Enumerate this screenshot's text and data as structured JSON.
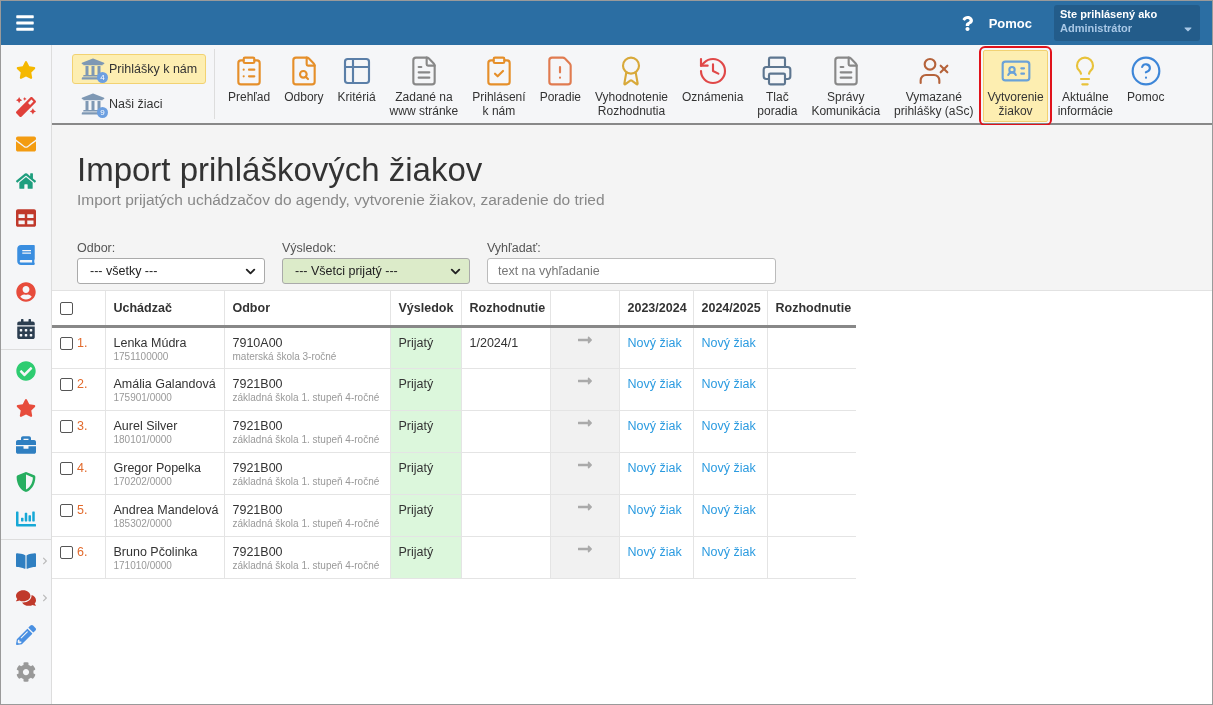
{
  "topbar": {
    "help": "Pomoc",
    "user_caption": "Ste prihlásený ako",
    "user_name": "Administrátor"
  },
  "side_buttons": [
    {
      "label": "Prihlášky k nám",
      "badge": "4",
      "selected": true
    },
    {
      "label": "Naši žiaci",
      "badge": "9",
      "selected": false
    }
  ],
  "toolbar": [
    {
      "label": "Prehľad",
      "selected": false
    },
    {
      "label": "Odbory",
      "selected": false
    },
    {
      "label": "Kritériá",
      "selected": false
    },
    {
      "label": "Zadané na\nwww stránke",
      "selected": false
    },
    {
      "label": "Prihlásení\nk nám",
      "selected": false
    },
    {
      "label": "Poradie",
      "selected": false
    },
    {
      "label": "Vyhodnotenie\nRozhodnutia",
      "selected": false
    },
    {
      "label": "Oznámenia",
      "selected": false
    },
    {
      "label": "Tlač\nporadia",
      "selected": false
    },
    {
      "label": "Správy\nKomunikácia",
      "selected": false
    },
    {
      "label": "Vymazané\nprihlášky (aSc)",
      "selected": false
    },
    {
      "label": "Vytvorenie\nžiakov",
      "selected": true
    },
    {
      "label": "Aktuálne\ninformácie",
      "selected": false
    },
    {
      "label": "Pomoc",
      "selected": false
    }
  ],
  "page": {
    "title": "Import prihláškových žiakov",
    "subtitle": "Import prijatých uchádzačov do agendy, vytvorenie žiakov, zaradenie do tried"
  },
  "filters": [
    {
      "kind": "select",
      "label": "Odbor:",
      "value": "--- všetky ---",
      "highlighted": false
    },
    {
      "kind": "select",
      "label": "Výsledok:",
      "value": "--- Všetci prijatý ---",
      "highlighted": true
    },
    {
      "kind": "text",
      "label": "Vyhľadať:",
      "placeholder": "text na vyhľadanie"
    }
  ],
  "table": {
    "select_all_checked": false,
    "columns": [
      "Uchádzač",
      "Odbor",
      "Výsledok",
      "Rozhodnutie",
      "2023/2024",
      "2024/2025",
      "Rozhodnutie"
    ],
    "rows": [
      {
        "checked": false,
        "number": "1.",
        "name": "Lenka Múdra",
        "id": "1751100000",
        "field_code": "7910A00",
        "field_name": "materská škola 3-ročné",
        "result": "Prijatý",
        "decision": "1/2024/1",
        "year_1": "Nový žiak",
        "year_2": "Nový žiak"
      },
      {
        "checked": false,
        "number": "2.",
        "name": "Amália Galandová",
        "id": "175901/0000",
        "field_code": "7921B00",
        "field_name": "základná škola 1. stupeň 4-ročné",
        "result": "Prijatý",
        "year_1": "Nový žiak",
        "year_2": "Nový žiak"
      },
      {
        "checked": false,
        "number": "3.",
        "name": "Aurel Silver",
        "id": "180101/0000",
        "field_code": "7921B00",
        "field_name": "základná škola 1. stupeň 4-ročné",
        "result": "Prijatý",
        "year_1": "Nový žiak",
        "year_2": "Nový žiak"
      },
      {
        "checked": false,
        "number": "4.",
        "name": "Gregor Popelka",
        "id": "170202/0000",
        "field_code": "7921B00",
        "field_name": "základná škola 1. stupeň 4-ročné",
        "result": "Prijatý",
        "year_1": "Nový žiak",
        "year_2": "Nový žiak"
      },
      {
        "checked": false,
        "number": "5.",
        "name": "Andrea Mandelová",
        "id": "185302/0000",
        "field_code": "7921B00",
        "field_name": "základná škola 1. stupeň 4-ročné",
        "result": "Prijatý",
        "year_1": "Nový žiak",
        "year_2": "Nový žiak"
      },
      {
        "checked": false,
        "number": "6.",
        "name": "Bruno Pčolinka",
        "id": "171010/0000",
        "field_code": "7921B00",
        "field_name": "základná škola 1. stupeň 4-ročné",
        "result": "Prijatý",
        "year_1": "Nový žiak",
        "year_2": "Nový žiak"
      }
    ]
  }
}
